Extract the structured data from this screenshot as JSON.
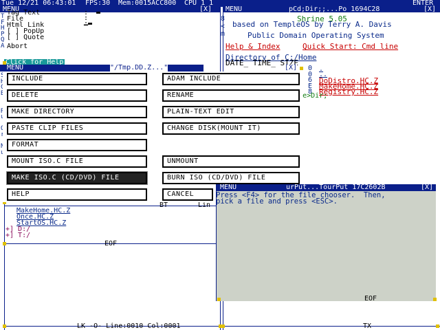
{
  "topbar": {
    "datetime": "Tue 12/21 06:43:01",
    "fps": "FPS:30",
    "mem": "Mem:0015ACC800",
    "cpu": "CPU 1 1",
    "enter": "ENTER"
  },
  "left_window": {
    "title": "MENU",
    "close": "[X]",
    "margin_letters": [
      "T",
      "F",
      "H",
      "P",
      "Q",
      "A",
      "",
      "",
      "",
      "P",
      "S",
      "H",
      "C",
      "B",
      "",
      "",
      "R",
      "u",
      "",
      "O",
      "r",
      "",
      "N",
      "u"
    ],
    "items": [
      "Tag Text",
      "File",
      "Html Link",
      "[ ] PopUp",
      "[ ] Quote",
      "Abort"
    ],
    "help_link": "Click for Help",
    "files": [
      "MakeHome.HC.Z",
      "Once.HC.Z",
      "StartOS.HC.Z"
    ],
    "dirs": [
      "+] D:/",
      "+] T:/"
    ],
    "eof": "EOF",
    "bt_label": "BT",
    "status": "LK -O- Line:0010 Col:0001"
  },
  "right_window": {
    "title": "MENU",
    "path_title": "pCd;Dir;;...Po 1694C28",
    "close": "[X]",
    "shrine": "Shrine 5.05",
    "subtitle": "based on TempleOS by Terry A. Davis",
    "pdos": "Public Domain Operating System",
    "help_index": "Help & Index",
    "quick_start": "Quick Start: Cmd line",
    "directory": "Directory of C:/Home",
    "headers": "DATE_ TIME_ SIZE",
    "dir_entries": [
      {
        "size": "0",
        "name": "."
      },
      {
        "size": "0",
        "name": ".."
      },
      {
        "size": "6",
        "name": "DoDistro.HC.Z"
      },
      {
        "size": "E",
        "name": "MakeHome.HC.Z"
      },
      {
        "size": "8",
        "name": "Registry.HC.Z"
      }
    ],
    "prompt": "C:/Home>Dir;",
    "tx_label": "TX",
    "side_letters": [
      "8",
      "<",
      "m"
    ]
  },
  "dialog": {
    "title": "MENU",
    "path": "\"/Tmp.DD.Z...\"",
    "close": "[X]",
    "buttons_left": [
      "INCLUDE",
      "DELETE",
      "MAKE DIRECTORY",
      "PASTE CLIP FILES",
      "FORMAT",
      "MOUNT ISO.C FILE",
      "MAKE ISO.C (CD/DVD) FILE",
      "HELP"
    ],
    "buttons_right": [
      "ADAM INCLUDE",
      "RENAME",
      "PLAIN-TEXT EDIT",
      "CHANGE DISK(MOUNT IT)",
      "UNMOUNT",
      "BURN ISO (CD/DVD) FILE",
      "CANCEL"
    ],
    "selected": "MAKE ISO.C (CD/DVD) FILE"
  },
  "popup": {
    "title": "MENU",
    "subtitle": "urPut...TourPut 17C2602B",
    "close": "[X]",
    "line1": "Press <F4> for the file chooser.  Then,",
    "line2": "pick a file and press <ESC>.",
    "eof": "EOF"
  },
  "colors": {
    "navy": "#0a1f8a",
    "cyan": "#1a9a9a",
    "red": "#c80000",
    "popup_bg": "#cdd2c8",
    "handle": "#e0c000"
  }
}
